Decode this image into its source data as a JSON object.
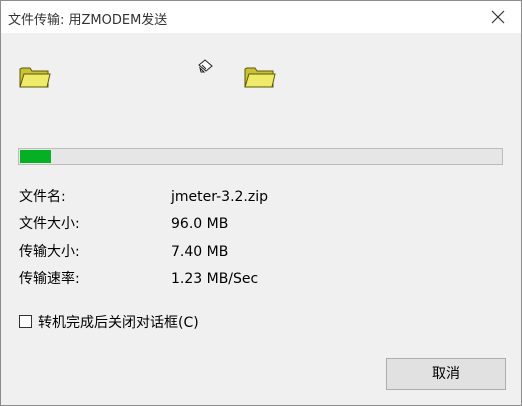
{
  "window": {
    "title": "文件传输: 用ZMODEM发送",
    "close_icon": "close-icon"
  },
  "icons": {
    "source_folder": "folder-icon",
    "target_folder": "folder-icon",
    "transfer_animation": "paper-transfer-icon"
  },
  "progress": {
    "fraction": 0.065,
    "fill_color": "#06b025"
  },
  "info": {
    "filename_label": "文件名:",
    "filename_value": "jmeter-3.2.zip",
    "filesize_label": "文件大小:",
    "filesize_value": "96.0 MB",
    "transferred_label": "传输大小:",
    "transferred_value": "7.40 MB",
    "rate_label": "传输速率:",
    "rate_value": "1.23 MB/Sec"
  },
  "options": {
    "close_after_complete_label": "转机完成后关闭对话框(C)",
    "close_after_complete_checked": false
  },
  "buttons": {
    "cancel_label": "取消"
  }
}
